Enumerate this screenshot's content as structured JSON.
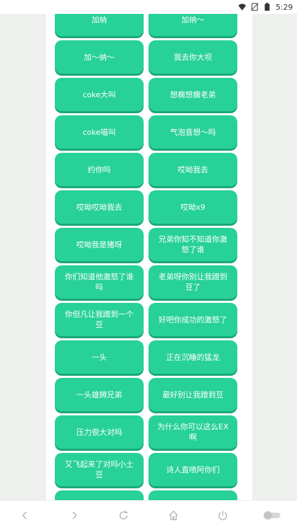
{
  "status": {
    "time": "5:29"
  },
  "buttons": [
    [
      "加纳",
      "加纳～"
    ],
    [
      "加～纳～",
      "我去你大坝"
    ],
    [
      "coke大叫",
      "想瘸想瘸老弟"
    ],
    [
      "coke喵叫",
      "气泡音想～吗"
    ],
    [
      "约你吗",
      "哎呦我去"
    ],
    [
      "哎呦哎呦我去",
      "哎呦x9"
    ],
    [
      "哎呦我是猪呀",
      "兄弟你知不知道你激怒了谁"
    ],
    [
      "你们知道他激怒了谁吗",
      "老弟呀你别让我蹭到豆了"
    ],
    [
      "你但凡让我蹭到一个豆",
      "好吧你成功的激怒了"
    ],
    [
      "一头",
      "正在沉睡的猛龙"
    ],
    [
      "一头雄狮兄弟",
      "最好别让我蹭到豆"
    ],
    [
      "压力很大对吗",
      "为什么你可以这么EX啊"
    ],
    [
      "又飞起来了对吗小土豆",
      "诗人直喷阿你们"
    ],
    [
      "",
      ""
    ]
  ],
  "nav": {
    "back": "chevron-left-icon",
    "forward": "chevron-right-icon",
    "refresh": "refresh-icon",
    "home": "home-icon",
    "power": "power-icon",
    "toggle": "toggle-icon"
  }
}
